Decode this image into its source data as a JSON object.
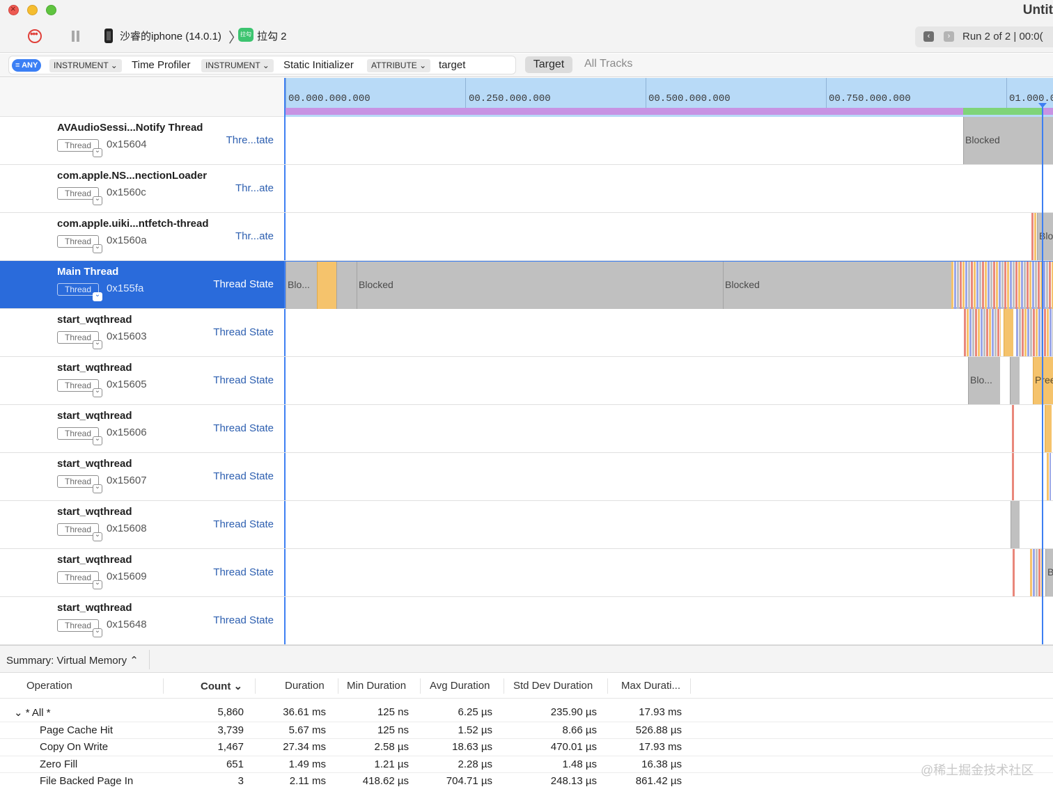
{
  "window": {
    "title": "Untit"
  },
  "toolbar": {
    "device_label": "沙睿的iphone (14.0.1)",
    "app_icon_text": "拉勾",
    "app_label": "拉勾 2",
    "run_label": "Run 2 of 2  |  00:0("
  },
  "filter": {
    "any_label": "≡ ANY",
    "tokens": [
      {
        "key": "INSTRUMENT ⌄",
        "value": "Time Profiler"
      },
      {
        "key": "INSTRUMENT ⌄",
        "value": "Static Initializer"
      },
      {
        "key": "ATTRIBUTE ⌄",
        "value": "target"
      }
    ],
    "target_button": "Target",
    "all_tracks_button": "All Tracks"
  },
  "ruler": {
    "labels": [
      "00.000.000.000",
      "00.250.000.000",
      "00.500.000.000",
      "00.750.000.000",
      "01.000.0"
    ]
  },
  "tracks": [
    {
      "name": "AVAudioSessi...Notify Thread",
      "badge": "Thread",
      "id": "0x15604",
      "kind": "Thre...tate",
      "selected": false,
      "segments": [
        {
          "type": "blocked",
          "start": 0.881,
          "end": 1.0,
          "label": "Blocked"
        }
      ]
    },
    {
      "name": "com.apple.NS...nectionLoader",
      "badge": "Thread",
      "id": "0x1560c",
      "kind": "Thr...ate",
      "selected": false,
      "segments": []
    },
    {
      "name": "com.apple.uiki...ntfetch-thread",
      "badge": "Thread",
      "id": "0x1560a",
      "kind": "Thr...ate",
      "selected": false,
      "segments": [
        {
          "type": "running",
          "start": 0.97,
          "end": 0.977,
          "label": ""
        },
        {
          "type": "blocked",
          "start": 0.977,
          "end": 1.0,
          "label": "Blocked"
        }
      ]
    },
    {
      "name": "Main Thread",
      "badge": "Thread",
      "id": "0x155fa",
      "kind": "Thread State",
      "selected": true,
      "segments": [
        {
          "type": "blocked",
          "start": 0.0,
          "end": 0.041,
          "label": "Blo..."
        },
        {
          "type": "preempted",
          "start": 0.041,
          "end": 0.066,
          "label": ""
        },
        {
          "type": "blocked",
          "start": 0.066,
          "end": 0.092,
          "label": ""
        },
        {
          "type": "blocked",
          "start": 0.092,
          "end": 0.569,
          "label": "Blocked"
        },
        {
          "type": "blocked",
          "start": 0.569,
          "end": 0.866,
          "label": "Blocked"
        },
        {
          "type": "running",
          "start": 0.866,
          "end": 1.0,
          "label": ""
        }
      ]
    },
    {
      "name": "start_wqthread",
      "badge": "Thread",
      "id": "0x15603",
      "kind": "Thread State",
      "selected": false,
      "segments": [
        {
          "type": "running",
          "start": 0.882,
          "end": 0.93,
          "label": ""
        },
        {
          "type": "preempted",
          "start": 0.934,
          "end": 0.947,
          "label": ""
        },
        {
          "type": "running",
          "start": 0.95,
          "end": 1.0,
          "label": ""
        }
      ]
    },
    {
      "name": "start_wqthread",
      "badge": "Thread",
      "id": "0x15605",
      "kind": "Thread State",
      "selected": false,
      "segments": [
        {
          "type": "blocked",
          "start": 0.888,
          "end": 0.93,
          "label": "Blo..."
        },
        {
          "type": "blocked",
          "start": 0.942,
          "end": 0.955,
          "label": ""
        },
        {
          "type": "preempted",
          "start": 0.972,
          "end": 1.0,
          "label": "Preempted"
        }
      ]
    },
    {
      "name": "start_wqthread",
      "badge": "Thread",
      "id": "0x15606",
      "kind": "Thread State",
      "selected": false,
      "segments": [
        {
          "type": "running",
          "start": 0.945,
          "end": 0.948,
          "label": ""
        },
        {
          "type": "preempted",
          "start": 0.987,
          "end": 0.996,
          "label": ""
        }
      ]
    },
    {
      "name": "start_wqthread",
      "badge": "Thread",
      "id": "0x15607",
      "kind": "Thread State",
      "selected": false,
      "segments": [
        {
          "type": "running",
          "start": 0.945,
          "end": 0.948,
          "label": ""
        },
        {
          "type": "running",
          "start": 0.99,
          "end": 0.995,
          "label": ""
        }
      ]
    },
    {
      "name": "start_wqthread",
      "badge": "Thread",
      "id": "0x15608",
      "kind": "Thread State",
      "selected": false,
      "segments": [
        {
          "type": "blocked",
          "start": 0.943,
          "end": 0.955,
          "label": ""
        }
      ]
    },
    {
      "name": "start_wqthread",
      "badge": "Thread",
      "id": "0x15609",
      "kind": "Thread State",
      "selected": false,
      "segments": [
        {
          "type": "running",
          "start": 0.946,
          "end": 0.949,
          "label": ""
        },
        {
          "type": "running",
          "start": 0.968,
          "end": 0.986,
          "label": ""
        },
        {
          "type": "blocked",
          "start": 0.988,
          "end": 1.0,
          "label": "Bl..."
        }
      ]
    },
    {
      "name": "start_wqthread",
      "badge": "Thread",
      "id": "0x15648",
      "kind": "Thread State",
      "selected": false,
      "segments": []
    }
  ],
  "summary": {
    "select_label": "Summary: Virtual Memory ⌃",
    "columns": [
      "Operation",
      "Count ⌄",
      "Duration",
      "Min Duration",
      "Avg Duration",
      "Std Dev Duration",
      "Max Durati..."
    ],
    "rows": [
      {
        "operation": "⌄  * All *",
        "count": "5,860",
        "duration": "36.61 ms",
        "min": "125 ns",
        "avg": "6.25 µs",
        "std": "235.90 µs",
        "max": "17.93 ms",
        "indent": 0
      },
      {
        "operation": "Page Cache Hit",
        "count": "3,739",
        "duration": "5.67 ms",
        "min": "125 ns",
        "avg": "1.52 µs",
        "std": "8.66 µs",
        "max": "526.88 µs",
        "indent": 1
      },
      {
        "operation": "Copy On Write",
        "count": "1,467",
        "duration": "27.34 ms",
        "min": "2.58 µs",
        "avg": "18.63 µs",
        "std": "470.01 µs",
        "max": "17.93 ms",
        "indent": 1
      },
      {
        "operation": "Zero Fill",
        "count": "651",
        "duration": "1.49 ms",
        "min": "1.21 µs",
        "avg": "2.28 µs",
        "std": "1.48 µs",
        "max": "16.38 µs",
        "indent": 1
      },
      {
        "operation": "File Backed Page In",
        "count": "3",
        "duration": "2.11 ms",
        "min": "418.62 µs",
        "avg": "704.71 µs",
        "std": "248.13 µs",
        "max": "861.42 µs",
        "indent": 1
      }
    ]
  },
  "watermark": "@稀土掘金技术社区",
  "colors": {
    "blocked": "#c0c0c0",
    "preempted": "#f5c36c",
    "running": "#e9877b",
    "selection": "#2a6bdb",
    "accent": "#3d7ff2"
  }
}
